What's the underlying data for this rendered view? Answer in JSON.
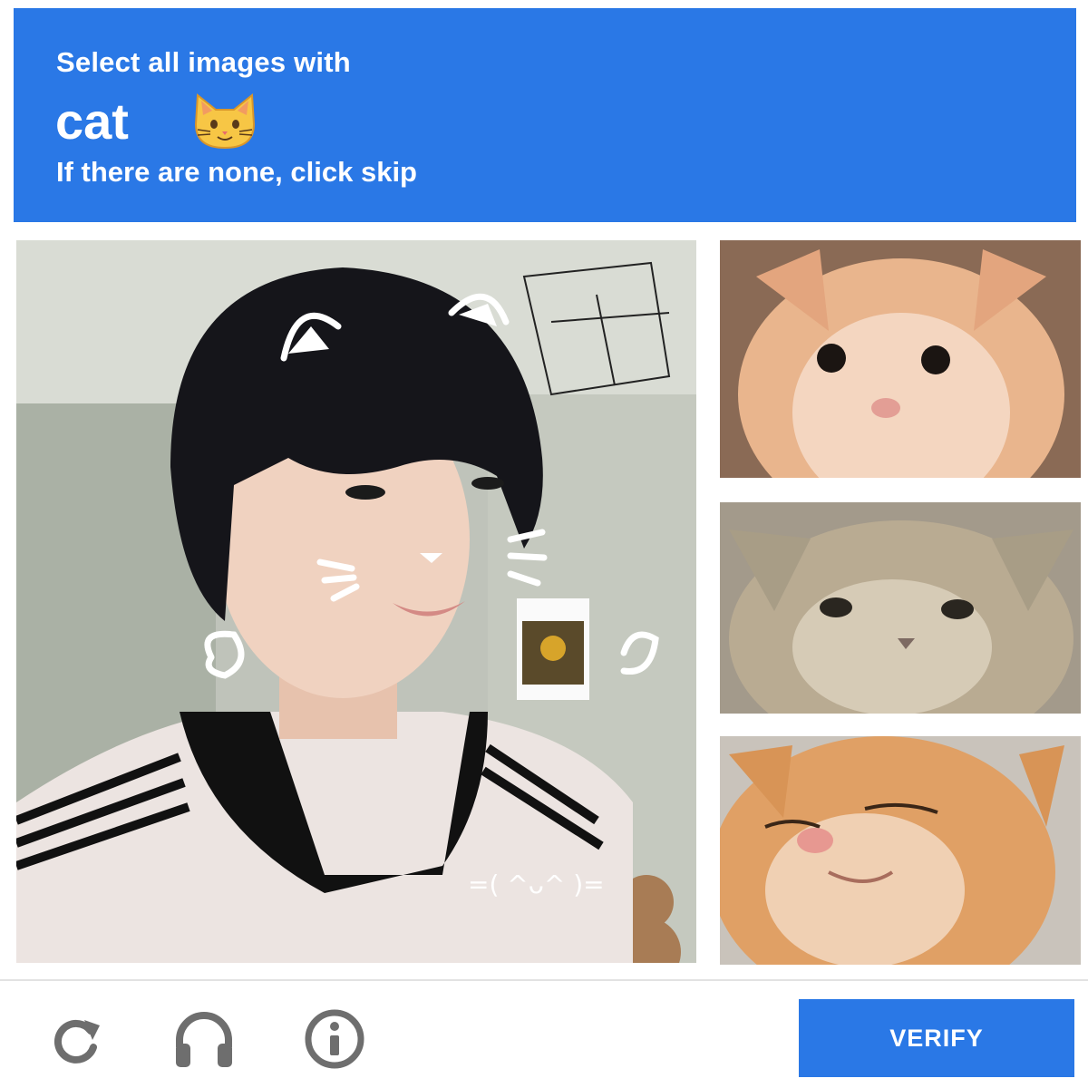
{
  "header": {
    "line1": "Select all images with",
    "target_word": "cat",
    "target_icon": "cat-face-emoji-icon",
    "line3": "If there are none, click skip",
    "background_color": "#2a78e6"
  },
  "tiles": [
    {
      "content": "selfie with cat-ear doodles"
    },
    {
      "content": "orange kitten"
    },
    {
      "content": "gray tabby kitten"
    },
    {
      "content": "orange cat squinting"
    }
  ],
  "controls": {
    "reload_icon": "reload-icon",
    "audio_icon": "headphones-icon",
    "info_icon": "info-icon"
  },
  "verify_button": {
    "label": "VERIFY",
    "color": "#2a78e6"
  }
}
